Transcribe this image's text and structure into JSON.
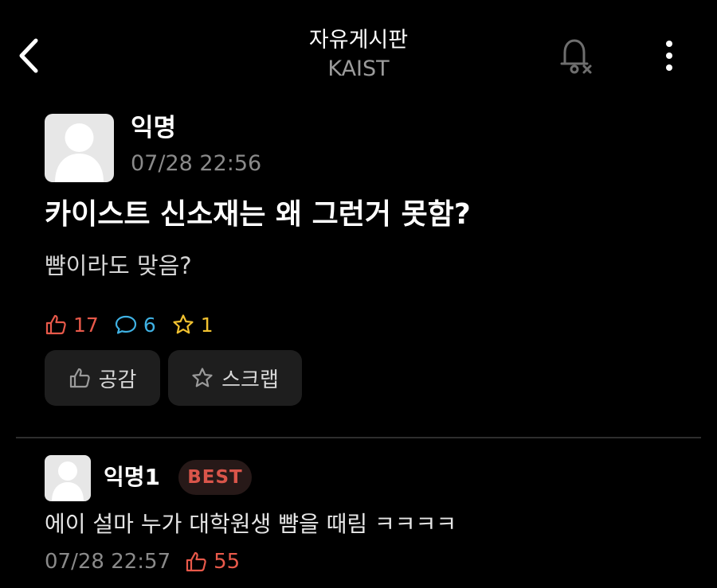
{
  "header": {
    "title": "자유게시판",
    "subtitle": "KAIST",
    "back_icon": "chevron-left-icon",
    "bell_icon": "bell-off-icon",
    "more_icon": "more-vertical-icon"
  },
  "post": {
    "author": "익명",
    "time": "07/28 22:56",
    "title": "카이스트 신소재는 왜 그런거 못함?",
    "body": "뺨이라도 맞음?",
    "stats": {
      "likes": "17",
      "comments": "6",
      "scraps": "1"
    },
    "actions": {
      "like_label": "공감",
      "scrap_label": "스크랩"
    }
  },
  "comments": [
    {
      "author": "익명1",
      "badge": "BEST",
      "text": "에이 설마 누가 대학원생 뺨을 때림 ㅋㅋㅋㅋ",
      "time": "07/28 22:57",
      "likes": "55"
    }
  ],
  "colors": {
    "background": "#000000",
    "like": "#e8594a",
    "comment": "#3fb1e3",
    "scrap": "#f2c230",
    "button_bg": "#1e1e1e",
    "muted": "#8a8a8a"
  }
}
